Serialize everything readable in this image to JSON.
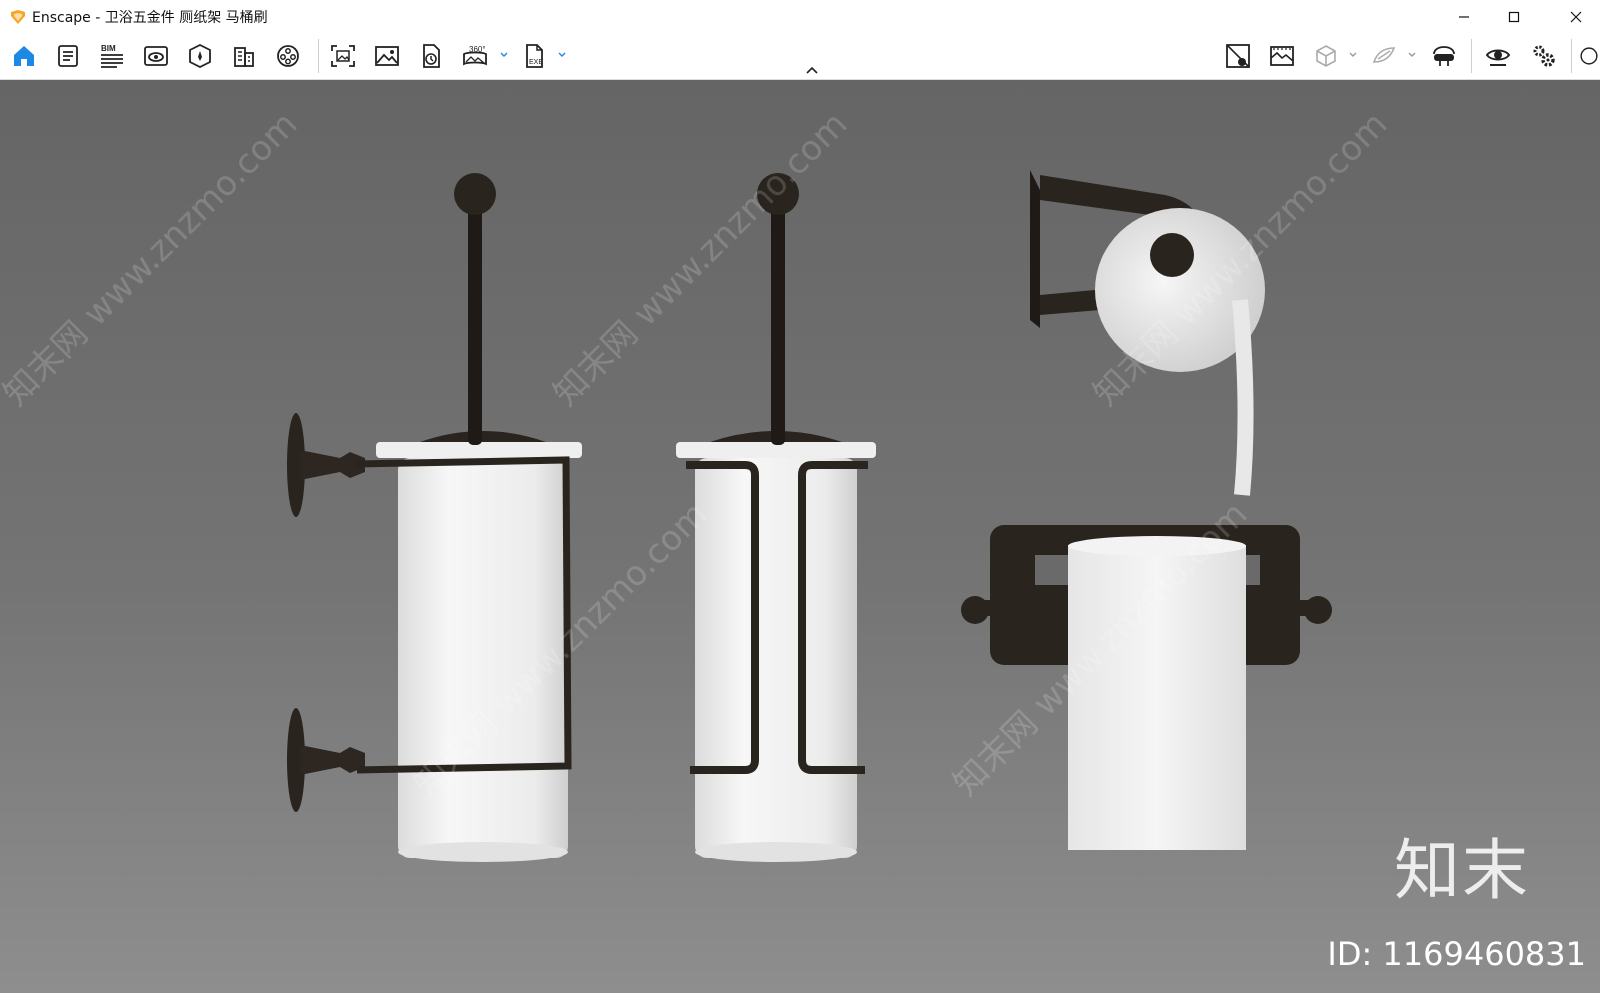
{
  "window": {
    "app_name": "Enscape",
    "title": "Enscape - 卫浴五金件 厕纸架 马桶刷",
    "controls": [
      "minimize",
      "maximize",
      "close"
    ]
  },
  "toolbar": {
    "left_icons": [
      "home-icon",
      "notes-icon",
      "bim-icon",
      "visual-settings-icon",
      "orientation-icon",
      "building-icon",
      "video-editor-icon"
    ],
    "capture_icons": [
      "screenshot-icon",
      "render-image-icon",
      "batch-render-icon",
      "panorama-360-icon",
      "export-exe-icon"
    ],
    "bim_label": "BIM",
    "pano_label": "360°",
    "exe_label": "EXE",
    "right_icons": [
      "material-editor-icon",
      "asset-library-icon",
      "cube-view-icon",
      "collaboration-icon",
      "vr-headset-icon",
      "live-view-icon",
      "settings-icon",
      "help-icon"
    ],
    "collapse_glyph": "^"
  },
  "viewport": {
    "description_colors": {
      "background": "#6e6e6e",
      "metal": "#2a241f",
      "ceramic": "#f4f4f4"
    },
    "watermark_text": "知末网 www.znzmo.com",
    "brand_text": "知末",
    "id_text": "ID: 1169460831"
  }
}
